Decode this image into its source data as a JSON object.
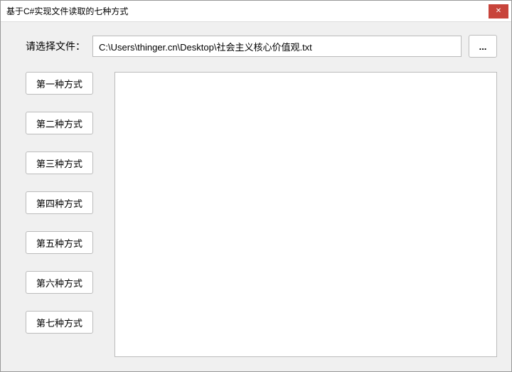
{
  "window": {
    "title": "基于C#实现文件读取的七种方式",
    "close_icon": "✕"
  },
  "file_selector": {
    "label": "请选择文件：",
    "path": "C:\\Users\\thinger.cn\\Desktop\\社会主义核心价值观.txt",
    "browse_label": "..."
  },
  "buttons": [
    {
      "label": "第一种方式"
    },
    {
      "label": "第二种方式"
    },
    {
      "label": "第三种方式"
    },
    {
      "label": "第四种方式"
    },
    {
      "label": "第五种方式"
    },
    {
      "label": "第六种方式"
    },
    {
      "label": "第七种方式"
    }
  ],
  "output": {
    "content": ""
  }
}
